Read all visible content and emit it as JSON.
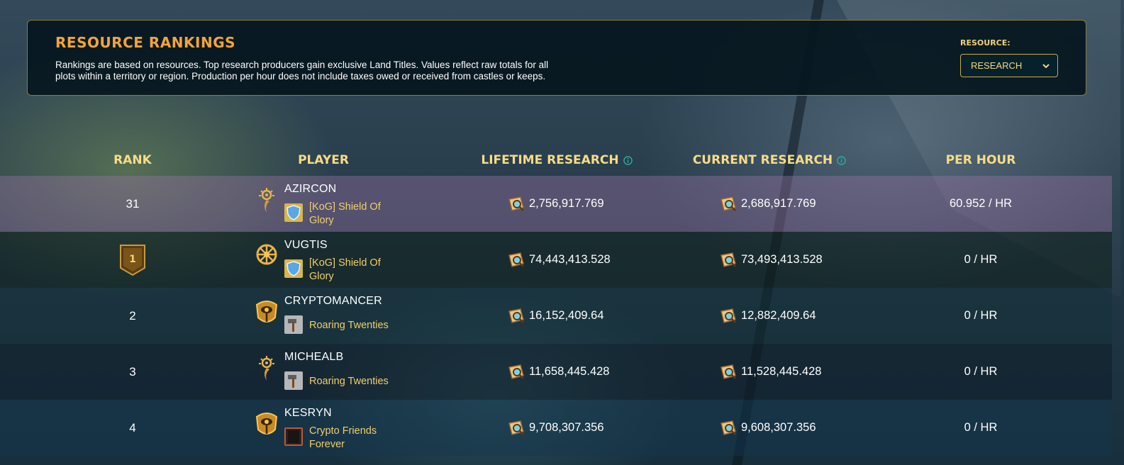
{
  "header": {
    "title": "RESOURCE RANKINGS",
    "description": "Rankings are based on resources. Top research producers gain exclusive Land Titles. Values reflect raw totals for all plots within a territory or region. Production per hour does not include taxes owed or received from castles or keeps.",
    "resource_label": "RESOURCE:",
    "resource_selected": "RESEARCH"
  },
  "columns": {
    "rank": "RANK",
    "player": "PLAYER",
    "lifetime": "LIFETIME RESEARCH",
    "current": "CURRENT RESEARCH",
    "per_hour": "PER HOUR"
  },
  "rows": [
    {
      "rank": "31",
      "player": "AZIRCON",
      "guild": "[KoG] Shield Of Glory",
      "lifetime": "2,756,917.769",
      "current": "2,686,917.769",
      "per_hour": "60.952 / HR",
      "class_icon": "sun-sigil-icon",
      "guild_icon": "blue-shield-icon"
    },
    {
      "rank": "1",
      "player": "VUGTIS",
      "guild": "[KoG] Shield Of Glory",
      "lifetime": "74,443,413.528",
      "current": "73,493,413.528",
      "per_hour": "0 / HR",
      "class_icon": "crest-icon",
      "guild_icon": "blue-shield-icon",
      "rank_badge": "gold-rank-badge"
    },
    {
      "rank": "2",
      "player": "CRYPTOMANCER",
      "guild": "Roaring Twenties",
      "lifetime": "16,152,409.64",
      "current": "12,882,409.64",
      "per_hour": "0 / HR",
      "class_icon": "eye-emblem-icon",
      "guild_icon": "hammer-icon"
    },
    {
      "rank": "3",
      "player": "MICHEALB",
      "guild": "Roaring Twenties",
      "lifetime": "11,658,445.428",
      "current": "11,528,445.428",
      "per_hour": "0 / HR",
      "class_icon": "sun-sigil-icon",
      "guild_icon": "hammer-icon"
    },
    {
      "rank": "4",
      "player": "KESRYN",
      "guild": "Crypto Friends Forever",
      "lifetime": "9,708,307.356",
      "current": "9,608,307.356",
      "per_hour": "0 / HR",
      "class_icon": "eye-emblem-icon",
      "guild_icon": "dark-banner-icon"
    }
  ],
  "icons": {
    "resource": "research-scroll-icon",
    "info": "info-icon",
    "dropdown": "chevron-down-icon"
  },
  "colors": {
    "accent_orange": "#f2a43a",
    "header_gold": "#f6dc86",
    "guild_gold": "#f0cf6a",
    "panel_border": "#8a7a3c",
    "info_teal": "#2bb3a7"
  }
}
